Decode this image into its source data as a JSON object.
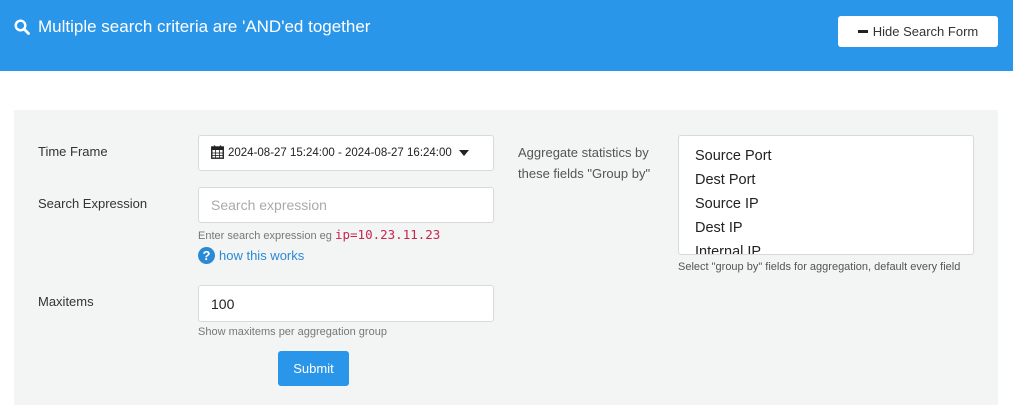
{
  "header": {
    "title": "Multiple search criteria are 'AND'ed together",
    "hide_button": "Hide Search Form"
  },
  "form": {
    "timeframe_label": "Time Frame",
    "timeframe_value": "2024-08-27 15:24:00 - 2024-08-27 16:24:00",
    "search_label": "Search Expression",
    "search_placeholder": "Search expression",
    "search_value": "",
    "search_help_prefix": "Enter search expression eg ",
    "search_help_code": "ip=10.23.11.23",
    "how_link": "how this works",
    "maxitems_label": "Maxitems",
    "maxitems_value": "100",
    "maxitems_help": "Show maxitems per aggregation group",
    "submit": "Submit"
  },
  "aggregate": {
    "label": "Aggregate statistics by these fields \"Group by\"",
    "options": [
      "Source Port",
      "Dest Port",
      "Source IP",
      "Dest IP",
      "Internal IP"
    ],
    "help": "Select \"group by\" fields for aggregation, default every field"
  },
  "colors": {
    "header_bg": "#2a96e9",
    "panel_bg": "#f3f4f4",
    "code": "#c7254e",
    "link": "#2a8ad6"
  },
  "icons": [
    "search-icon",
    "minus-icon",
    "calendar-icon",
    "caret-down-icon",
    "question-circle-icon"
  ]
}
